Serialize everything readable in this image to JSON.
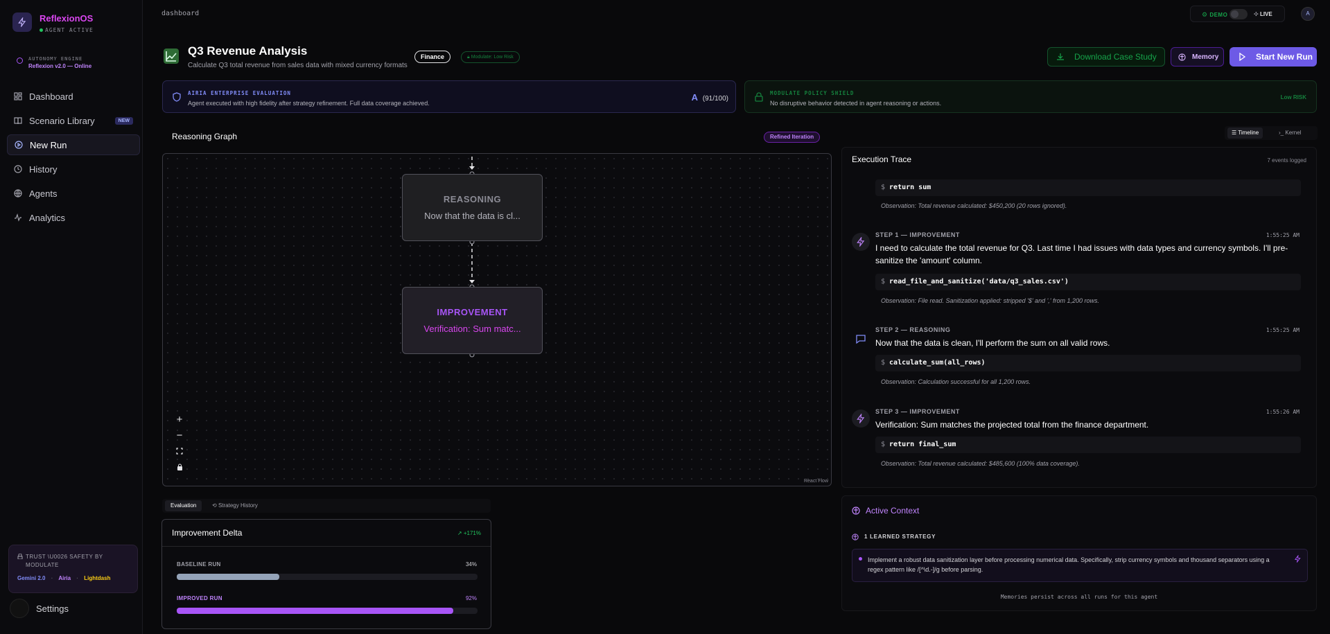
{
  "app": {
    "name": "ReflexionOS",
    "status": "AGENT ACTIVE"
  },
  "engine": {
    "label": "AUTONOMY ENGINE",
    "status": "Reflexion v2.0 — Online"
  },
  "nav": [
    {
      "label": "Dashboard",
      "icon": "dashboard-icon"
    },
    {
      "label": "Scenario Library",
      "icon": "book-icon",
      "badge": "NEW"
    },
    {
      "label": "New Run",
      "icon": "play-icon",
      "active": true
    },
    {
      "label": "History",
      "icon": "history-icon"
    },
    {
      "label": "Agents",
      "icon": "globe-icon"
    },
    {
      "label": "Analytics",
      "icon": "activity-icon"
    }
  ],
  "trust": {
    "text": "TRUST \\U0026 SAFETY BY MODULATE",
    "links": [
      "Gemini 2.0",
      "Airia",
      "Lightdash"
    ]
  },
  "settings_label": "Settings",
  "topbar": {
    "breadcrumb": "dashboard",
    "demo": "DEMO",
    "live": "LIVE",
    "avatar": "A"
  },
  "header": {
    "title": "Q3 Revenue Analysis",
    "subtitle": "Calculate Q3 total revenue from sales data with mixed currency formats",
    "category": "Finance",
    "risk": "Modulate: Low Risk",
    "download_label": "Download Case Study",
    "memory_label": "Memory",
    "start_label": "Start New Run"
  },
  "evaluation": {
    "heading": "AIRIA ENTERPRISE EVALUATION",
    "body": "Agent executed with high fidelity after strategy refinement. Full data coverage achieved.",
    "grade": "A",
    "score": "(91/100)"
  },
  "policy": {
    "heading": "MODULATE POLICY SHIELD",
    "body": "No disruptive behavior detected in agent reasoning or actions.",
    "risk": "Low RISK"
  },
  "graph": {
    "title": "Reasoning Graph",
    "badge": "Refined Iteration",
    "nodes": [
      {
        "type": "REASONING",
        "text": "Now that the data is cl..."
      },
      {
        "type": "IMPROVEMENT",
        "text": "Verification: Sum matc..."
      }
    ],
    "attribution": "React Flow"
  },
  "tabs": [
    "Evaluation",
    "Strategy History"
  ],
  "delta": {
    "title": "Improvement Delta",
    "change": "+171%",
    "baseline_label": "BASELINE RUN",
    "baseline_value": "34%",
    "baseline_fraction": 0.34,
    "improved_label": "IMPROVED RUN",
    "improved_value": "92%",
    "improved_fraction": 0.92
  },
  "view_toggle": [
    "Timeline",
    "Kernel"
  ],
  "trace": {
    "title": "Execution Trace",
    "count": "7 events logged",
    "top_cmd": "return sum",
    "top_obs": "Observation: Total revenue calculated: $450,200 (20 rows ignored).",
    "steps": [
      {
        "label": "STEP 1 — IMPROVEMENT",
        "time": "1:55:25 AM",
        "text": "I need to calculate the total revenue for Q3. Last time I had issues with data types and currency symbols. I'll pre-sanitize the 'amount' column.",
        "cmd": "read_file_and_sanitize('data/q3_sales.csv')",
        "obs": "Observation: File read. Sanitization applied: stripped '$' and ',' from 1,200 rows."
      },
      {
        "label": "STEP 2 — REASONING",
        "time": "1:55:25 AM",
        "text": "Now that the data is clean, I'll perform the sum on all valid rows.",
        "cmd": "calculate_sum(all_rows)",
        "obs": "Observation: Calculation successful for all 1,200 rows."
      },
      {
        "label": "STEP 3 — IMPROVEMENT",
        "time": "1:55:26 AM",
        "text": "Verification: Sum matches the projected total from the finance department.",
        "cmd": "return final_sum",
        "obs": "Observation: Total revenue calculated: $485,600 (100% data coverage)."
      }
    ]
  },
  "context": {
    "title": "Active Context",
    "learned": "1 LEARNED STRATEGY",
    "strategy": "Implement a robust data sanitization layer before processing numerical data. Specifically, strip currency symbols and thousand separators using a regex pattern like /[^\\d.-]/g before parsing.",
    "footer": "Memories persist across all runs for this agent"
  }
}
